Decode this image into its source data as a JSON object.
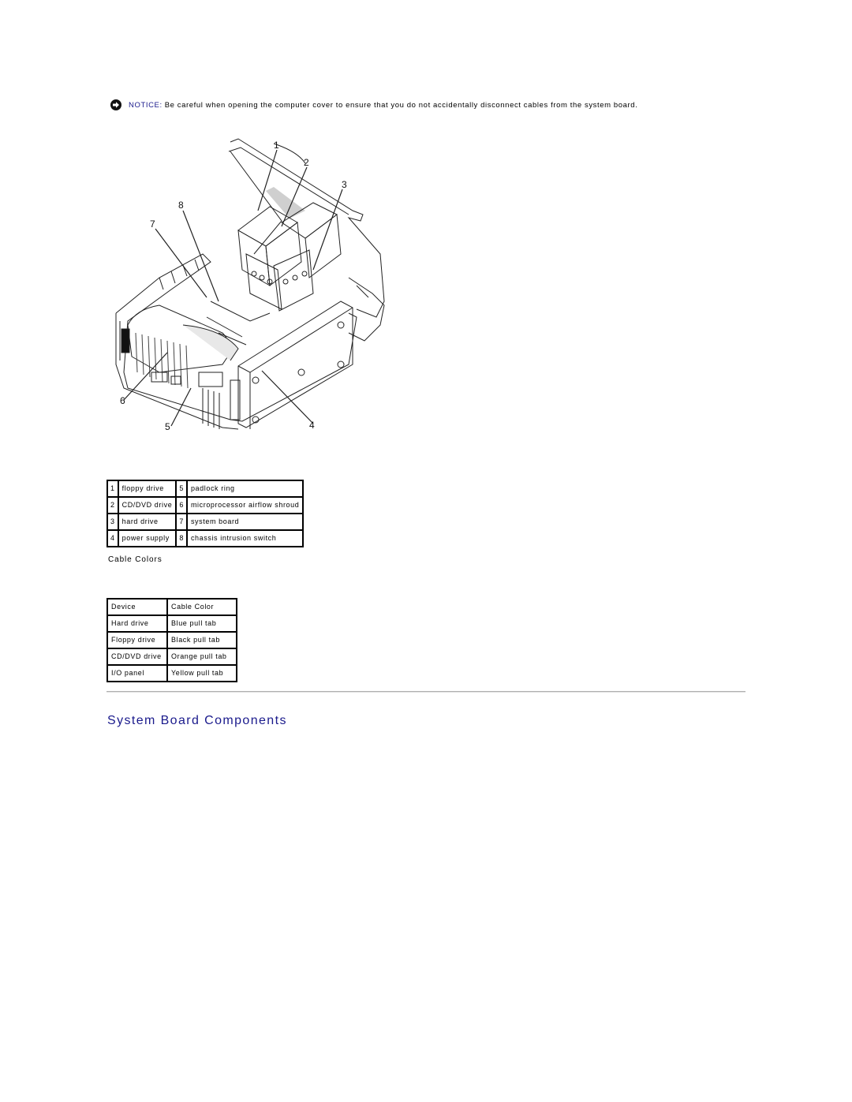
{
  "notice": {
    "icon": "notice-arrow-icon",
    "label": "NOTICE:",
    "text": "Be careful when opening the computer cover to ensure that you do not accidentally disconnect cables from the system board."
  },
  "figure": {
    "description": "Open computer chassis diagram with numbered callouts",
    "callouts": [
      "1",
      "2",
      "3",
      "4",
      "5",
      "6",
      "7",
      "8"
    ]
  },
  "components_table": {
    "rows": [
      {
        "n1": "1",
        "c1": "floppy drive",
        "n2": "5",
        "c2": "padlock ring"
      },
      {
        "n1": "2",
        "c1": "CD/DVD drive",
        "n2": "6",
        "c2": "microprocessor airflow shroud"
      },
      {
        "n1": "3",
        "c1": "hard drive",
        "n2": "7",
        "c2": "system board"
      },
      {
        "n1": "4",
        "c1": "power supply",
        "n2": "8",
        "c2": "chassis intrusion switch"
      }
    ]
  },
  "cable_colors": {
    "heading": "Cable Colors",
    "headers": [
      "Device",
      "Cable Color"
    ],
    "rows": [
      [
        "Hard drive",
        "Blue pull tab"
      ],
      [
        "Floppy drive",
        "Black pull tab"
      ],
      [
        "CD/DVD drive",
        "Orange pull tab"
      ],
      [
        "I/O panel",
        "Yellow pull tab"
      ]
    ]
  },
  "section": {
    "title": "System Board Components"
  },
  "colors": {
    "link_blue": "#1a1a8c"
  }
}
